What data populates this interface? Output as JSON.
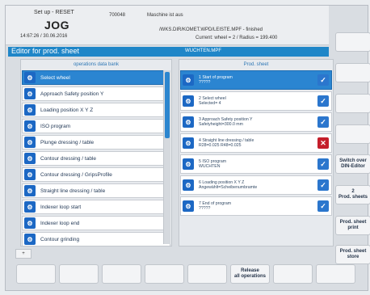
{
  "header": {
    "setup_label": "Set up - RESET",
    "mode": "JOG",
    "timestamp": "14:67:26 / 30.06.2016",
    "code": "700048",
    "message": "Maschine ist aus",
    "path": "/WKS.DIR/KOMET.WPD/LEISTE.MPF - finished",
    "current": "Current:  wheel = 2  /  Radius = 199.400"
  },
  "titlebar": {
    "title": "Editor for prod. sheet",
    "right": "WUCHTEN.MPF"
  },
  "left_panel": {
    "title": "operations data bank",
    "items": [
      {
        "label": "Select wheel",
        "icon": "wheel-icon",
        "selected": true
      },
      {
        "label": "Approach Safety  position Y",
        "icon": "safety-icon",
        "selected": false
      },
      {
        "label": "Loading position X Y Z",
        "icon": "loading-icon",
        "selected": false
      },
      {
        "label": "ISO program",
        "icon": "iso-program-icon",
        "selected": false
      },
      {
        "label": "Plunge dressing  / table",
        "icon": "plunge-dressing-icon",
        "selected": false
      },
      {
        "label": "Contour dressing  / table",
        "icon": "contour-dressing-icon",
        "selected": false
      },
      {
        "label": "Contour dressing  / GripsProfile",
        "icon": "contour-dressing-icon",
        "selected": false
      },
      {
        "label": "Straight line dressing   / table",
        "icon": "straight-dressing-icon",
        "selected": false
      },
      {
        "label": "Indexer loop start",
        "icon": "indexer-start-icon",
        "selected": false
      },
      {
        "label": "Indexer loop end",
        "icon": "indexer-end-icon",
        "selected": false
      },
      {
        "label": "Contour grinding",
        "icon": "contour-grinding-icon",
        "selected": false
      }
    ]
  },
  "right_panel": {
    "title": "Prod. sheet",
    "items": [
      {
        "line1": "1 Start of program",
        "line2": "?????",
        "icon": "start-program-icon",
        "status": "ok",
        "selected": true
      },
      {
        "line1": "2 Select wheel",
        "line2": "Selected= 4",
        "icon": "wheel-icon",
        "status": "ok",
        "selected": false
      },
      {
        "line1": "3 Approach Safety  position Y",
        "line2": "Safetyheight=300.0 mm",
        "icon": "safety-icon",
        "status": "ok",
        "selected": false
      },
      {
        "line1": "4 Straight line dressing   / table",
        "line2": "R28=0.025 R48=0.025",
        "icon": "straight-dressing-icon",
        "status": "err",
        "selected": false
      },
      {
        "line1": "5 ISO program",
        "line2": "WUCHTEN",
        "icon": "iso-program-icon",
        "status": "ok",
        "selected": false
      },
      {
        "line1": "6 Loading position X Y Z",
        "line2": "Angewählt=Scheibenumbramte",
        "icon": "loading-icon",
        "status": "ok",
        "selected": false
      },
      {
        "line1": "7 End of program",
        "line2": "?????",
        "icon": "end-program-icon",
        "status": "ok",
        "selected": false
      }
    ]
  },
  "softkeys": {
    "switch_din": "Switch over\nDIN-Editor",
    "prod_sheets": "2\nProd. sheets",
    "prod_sheet_print": "Prod. sheet\nprint",
    "prod_sheet_store": "Prod. sheet\nstore"
  },
  "bottom_softkeys": {
    "release": "Release\nall operations"
  },
  "stepper": {
    "symbol": "+"
  },
  "colors": {
    "accent": "#1f86c8",
    "selected_row": "#2b85d1",
    "ok_check": "#2b76cd",
    "error_x": "#c41e2b"
  }
}
